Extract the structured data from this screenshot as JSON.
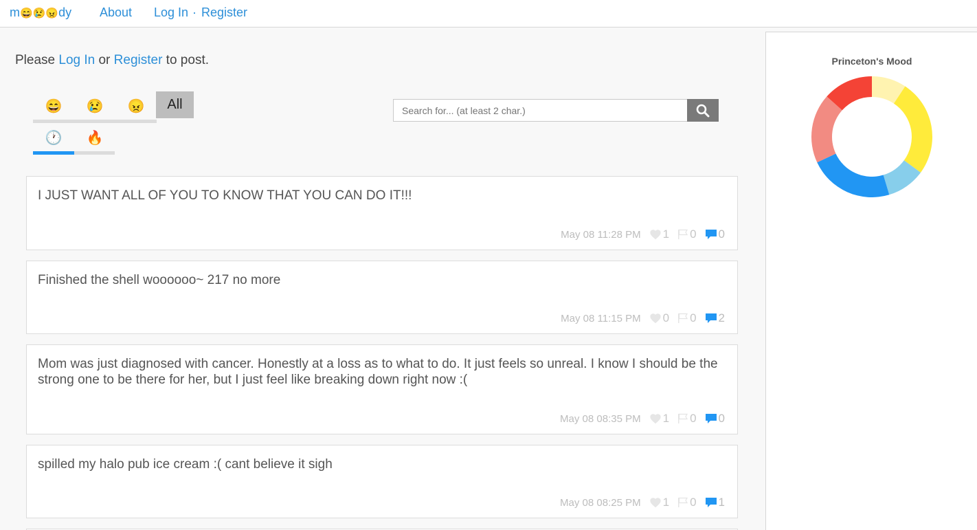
{
  "nav": {
    "brand_prefix": "m",
    "brand_emojis": [
      "😄",
      "😢",
      "😠"
    ],
    "brand_suffix": "dy",
    "about": "About",
    "login": "Log In",
    "separator": "·",
    "register": "Register"
  },
  "notice": {
    "prefix": "Please ",
    "login": "Log In",
    "middle": " or ",
    "register": "Register",
    "suffix": " to post."
  },
  "filters": {
    "moods": [
      "😄",
      "😢",
      "😠"
    ],
    "all_label": "All",
    "sorts": [
      "🕐",
      "🔥"
    ],
    "active_sort": "recent"
  },
  "search": {
    "placeholder": "Search for... (at least 2 char.)",
    "icon": "search-icon"
  },
  "posts": [
    {
      "text": "I JUST WANT ALL OF YOU TO KNOW THAT YOU CAN DO IT!!!",
      "time": "May 08 11:28 PM",
      "likes": "1",
      "flags": "0",
      "comments": "0"
    },
    {
      "text": "Finished the shell woooooo~ 217 no more",
      "time": "May 08 11:15 PM",
      "likes": "0",
      "flags": "0",
      "comments": "2"
    },
    {
      "text": "Mom was just diagnosed with cancer. Honestly at a loss as to what to do. It just feels so unreal. I know I should be the strong one to be there for her, but I just feel like breaking down right now :(",
      "time": "May 08 08:35 PM",
      "likes": "1",
      "flags": "0",
      "comments": "0"
    },
    {
      "text": "spilled my halo pub ice cream :( cant believe it sigh",
      "time": "May 08 08:25 PM",
      "likes": "1",
      "flags": "0",
      "comments": "1"
    }
  ],
  "mood_chart": {
    "title": "Princeton's Mood",
    "colors": [
      "#fff3b0",
      "#ffeb3b",
      "#87ceeb",
      "#2196f3",
      "#f28b82",
      "#f44336"
    ]
  },
  "chart_data": {
    "type": "pie",
    "title": "Princeton's Mood",
    "values": [
      9,
      25,
      10,
      22,
      18,
      13
    ],
    "colors": [
      "#fff3b0",
      "#ffeb3b",
      "#87ceeb",
      "#2196f3",
      "#f28b82",
      "#f44336"
    ]
  }
}
